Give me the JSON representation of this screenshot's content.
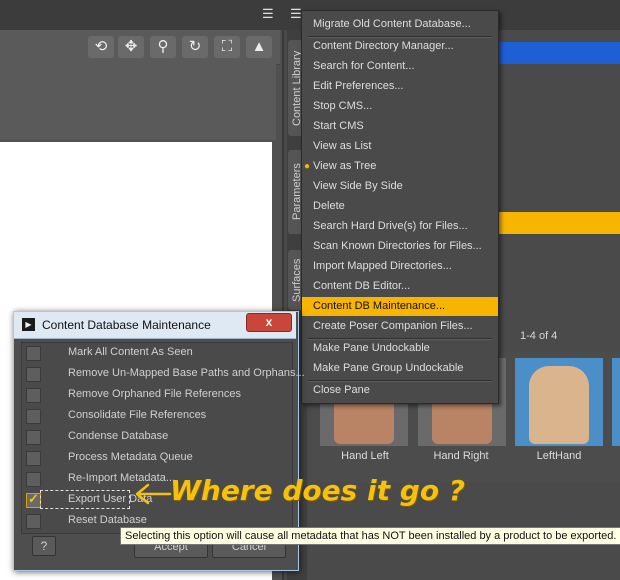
{
  "context_menu": {
    "items": [
      {
        "label": "Migrate Old Content Database...",
        "selected": false
      },
      {
        "label": "Content Directory Manager...",
        "selected": false
      },
      {
        "label": "Search for Content...",
        "selected": false
      },
      {
        "label": "Edit Preferences...",
        "selected": false
      },
      {
        "label": "Stop CMS...",
        "selected": false
      },
      {
        "label": "Start CMS",
        "selected": false
      },
      {
        "label": "View as List",
        "selected": false
      },
      {
        "label": "View as Tree",
        "selected": false
      },
      {
        "label": "View Side By Side",
        "selected": false
      },
      {
        "label": "Delete",
        "selected": false
      },
      {
        "label": "Search Hard Drive(s) for Files...",
        "selected": false
      },
      {
        "label": "Scan Known Directories for Files...",
        "selected": false
      },
      {
        "label": "Import Mapped Directories...",
        "selected": false
      },
      {
        "label": "Content DB Editor...",
        "selected": false
      },
      {
        "label": "Content DB Maintenance...",
        "selected": true
      },
      {
        "label": "Create Poser Companion Files...",
        "selected": false
      },
      {
        "label": "Make Pane Undockable",
        "selected": false
      },
      {
        "label": "Make Pane Group Undockable",
        "selected": false
      },
      {
        "label": "Close Pane",
        "selected": false
      }
    ]
  },
  "side_tabs": {
    "content_library": "Content Library",
    "parameters": "Parameters",
    "surfaces": "Surfaces"
  },
  "content_pane": {
    "pager": "1-4 of 4",
    "thumbnails": [
      {
        "label": "Hand Left"
      },
      {
        "label": "Hand Right"
      },
      {
        "label": "LeftHand"
      }
    ]
  },
  "dialog": {
    "title": "Content Database Maintenance",
    "close_label": "x",
    "options": [
      {
        "label": "Mark All Content As Seen",
        "checked": false
      },
      {
        "label": "Remove Un-Mapped Base Paths and Orphans...",
        "checked": false
      },
      {
        "label": "Remove Orphaned File References",
        "checked": false
      },
      {
        "label": "Consolidate File References",
        "checked": false
      },
      {
        "label": "Condense Database",
        "checked": false
      },
      {
        "label": "Process Metadata Queue",
        "checked": false
      },
      {
        "label": "Re-Import Metadata...",
        "checked": false
      },
      {
        "label": "Export User Data",
        "checked": true
      },
      {
        "label": "Reset Database",
        "checked": false
      }
    ],
    "help_label": "?",
    "accept_label": "Accept",
    "cancel_label": "Cancel"
  },
  "tooltip": {
    "text": "Selecting this option will cause all metadata that has NOT been installed by a product to be exported."
  },
  "annotation": {
    "text": "Where does it go ?",
    "color": "#f5c10a"
  },
  "colors": {
    "menu_highlight": "#f7b500",
    "selection_blue": "#1f5fd6"
  }
}
